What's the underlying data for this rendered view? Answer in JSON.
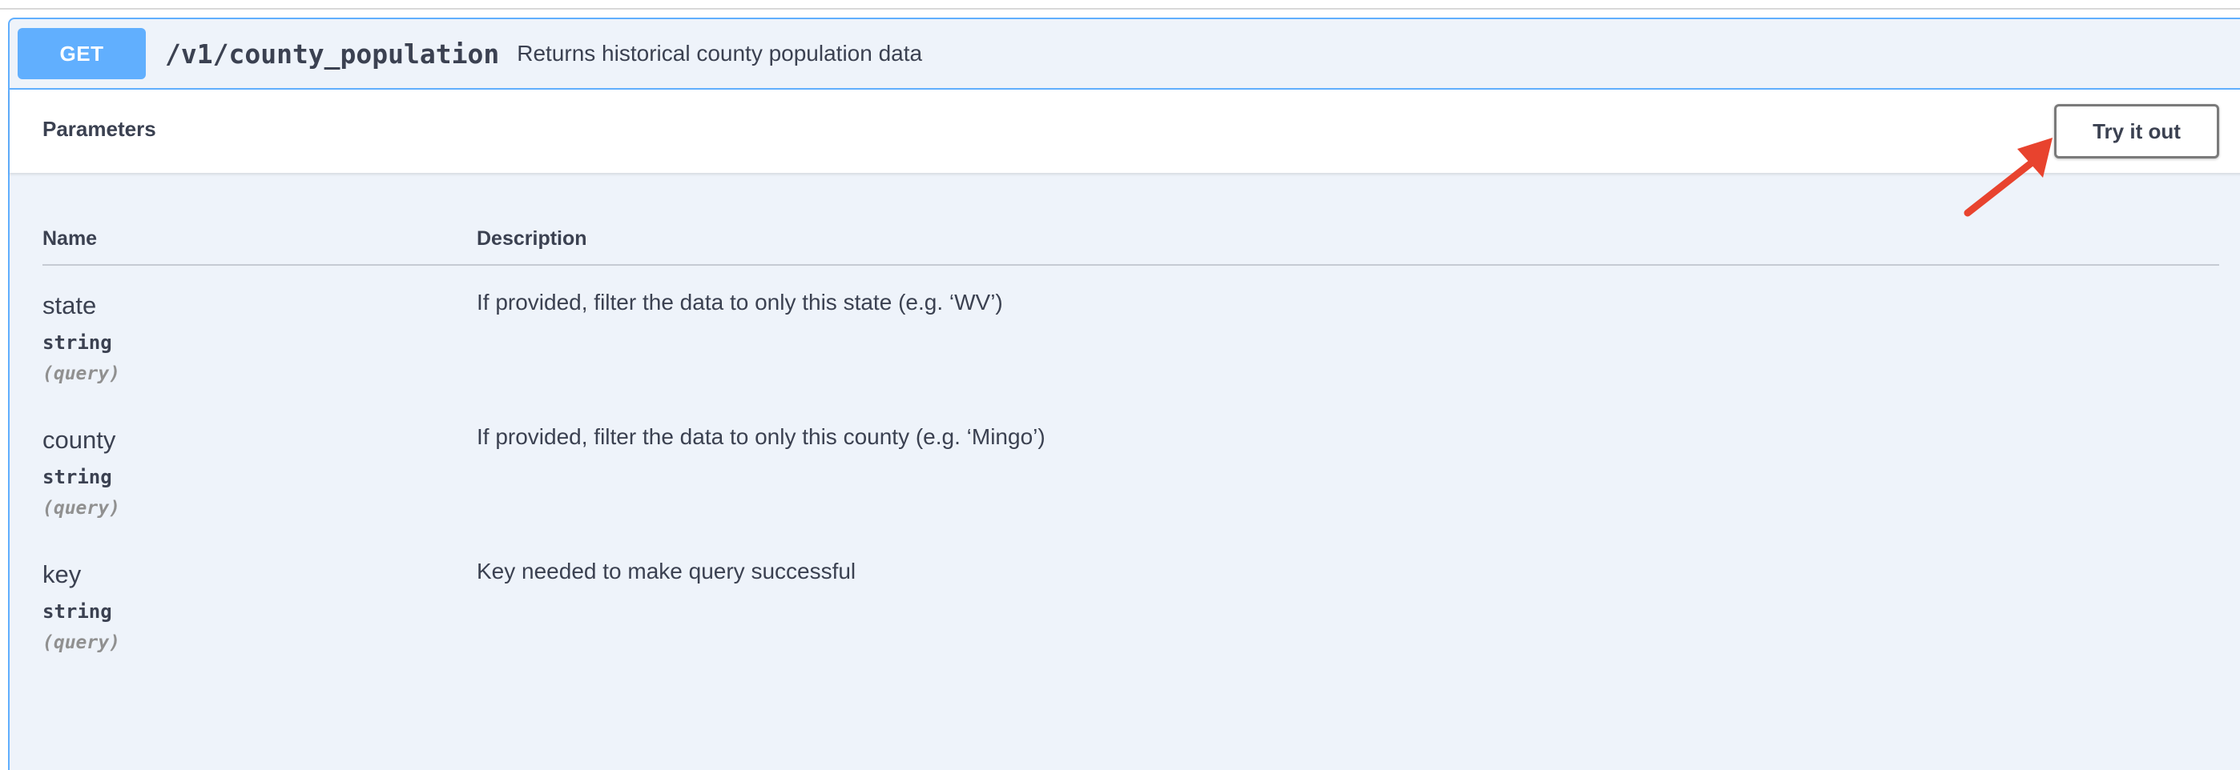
{
  "operation": {
    "method": "GET",
    "path": "/v1/county_population",
    "summary": "Returns historical county population data"
  },
  "parameters_section": {
    "title": "Parameters",
    "try_button_label": "Try it out"
  },
  "table": {
    "headers": {
      "name": "Name",
      "description": "Description"
    },
    "rows": [
      {
        "name": "state",
        "type": "string",
        "in": "(query)",
        "description": "If provided, filter the data to only this state (e.g. ‘WV’)"
      },
      {
        "name": "county",
        "type": "string",
        "in": "(query)",
        "description": "If provided, filter the data to only this county (e.g. ‘Mingo’)"
      },
      {
        "name": "key",
        "type": "string",
        "in": "(query)",
        "description": "Key needed to make query successful"
      }
    ]
  },
  "colors": {
    "get_accent": "#61affe",
    "block_background": "#eef3fa",
    "annotation_arrow": "#e8432e"
  },
  "icons": {
    "annotation": "arrow-pointer-icon"
  }
}
